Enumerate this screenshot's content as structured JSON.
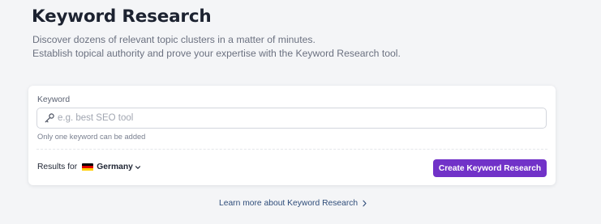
{
  "header": {
    "title": "Keyword Research",
    "subtitle_line1": "Discover dozens of relevant topic clusters in a matter of minutes.",
    "subtitle_line2": "Establish topical authority and prove your expertise with the Keyword Research tool."
  },
  "form": {
    "keyword_label": "Keyword",
    "keyword_value": "",
    "keyword_placeholder": "e.g. best SEO tool",
    "keyword_hint": "Only one keyword can be added",
    "results_for_label": "Results for",
    "country": "Germany",
    "submit_label": "Create Keyword Research"
  },
  "footer": {
    "learn_more_label": "Learn more about Keyword Research"
  },
  "colors": {
    "accent": "#7132c8",
    "link": "#2f4d7a",
    "background": "#f4f5f7"
  },
  "icons": {
    "input_icon": "key-icon",
    "country_flag": "germany-flag-icon",
    "dropdown": "chevron-down-icon",
    "link_arrow": "chevron-right-icon"
  }
}
